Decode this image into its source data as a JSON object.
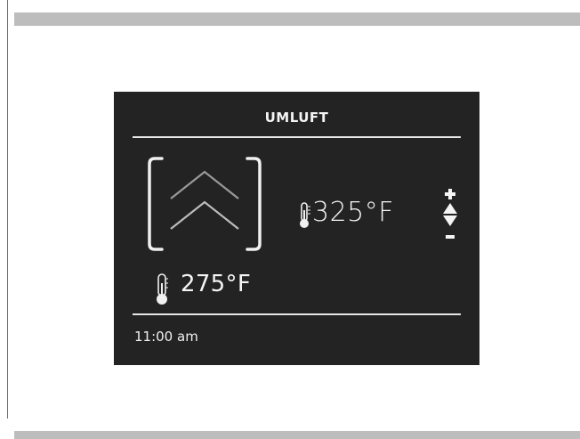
{
  "display": {
    "mode_title": "UMLUFT",
    "mode_icon": "convection-chevron-icon",
    "set_temperature": "325°F",
    "current_temperature": "275°F",
    "clock": "11:00 am",
    "controls": {
      "increase_icon": "plus-icon",
      "up_icon": "triangle-up-icon",
      "down_icon": "triangle-down-icon",
      "decrease_icon": "minus-icon"
    }
  },
  "colors": {
    "screen_background": "#232323",
    "foreground": "#f2f2f2",
    "page_bars": "#bdbdbd"
  }
}
